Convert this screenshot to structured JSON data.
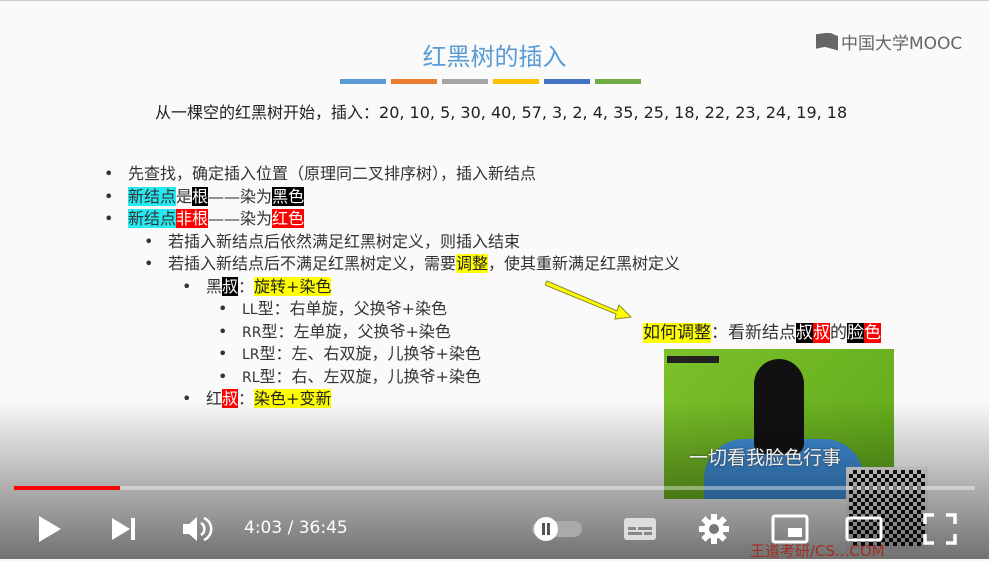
{
  "slide": {
    "title": "红黑树的插入",
    "logo": "中国大学MOOC",
    "title_bar_colors": [
      "#5b9bd5",
      "#ed7d31",
      "#a5a5a5",
      "#ffc000",
      "#4472c4",
      "#70ad47"
    ],
    "sequence_label": "从一棵空的红黑树开始，插入：",
    "sequence": "20, 10, 5, 30, 40, 57, 3, 2, 4, 35, 25, 18, 22, 23, 24, 19, 18",
    "lines": [
      [
        {
          "t": "先查找，确定插入位置（原理同二叉排序树），插入新结点",
          "s": ""
        }
      ],
      [
        {
          "t": "新结点",
          "s": "cyan"
        },
        {
          "t": "是",
          "s": ""
        },
        {
          "t": "根",
          "s": "black"
        },
        {
          "t": "——染为",
          "s": ""
        },
        {
          "t": "黑色",
          "s": "black"
        }
      ],
      [
        {
          "t": "新结点",
          "s": "cyan"
        },
        {
          "t": "非根",
          "s": "red"
        },
        {
          "t": "——染为",
          "s": ""
        },
        {
          "t": "红色",
          "s": "red"
        }
      ],
      [
        {
          "t": "若插入新结点后依然满足红黑树定义，则插入结束",
          "s": ""
        }
      ],
      [
        {
          "t": "若插入新结点后不满足红黑树定义，需要",
          "s": ""
        },
        {
          "t": "调整",
          "s": "yellow"
        },
        {
          "t": "，使其重新满足红黑树定义",
          "s": ""
        }
      ],
      [
        {
          "t": "黑",
          "s": ""
        },
        {
          "t": "叔",
          "s": "black"
        },
        {
          "t": "：",
          "s": ""
        },
        {
          "t": "旋转+染色",
          "s": "yellow"
        }
      ],
      [
        {
          "t": "LL",
          "s": "latin"
        },
        {
          "t": "型：右单旋，父换爷+染色",
          "s": ""
        }
      ],
      [
        {
          "t": "RR",
          "s": "latin"
        },
        {
          "t": "型：左单旋，父换爷+染色",
          "s": ""
        }
      ],
      [
        {
          "t": "LR",
          "s": "latin"
        },
        {
          "t": "型：左、右双旋，儿换爷+染色",
          "s": ""
        }
      ],
      [
        {
          "t": "RL",
          "s": "latin"
        },
        {
          "t": "型：右、左双旋，儿换爷+染色",
          "s": ""
        }
      ],
      [
        {
          "t": "红",
          "s": ""
        },
        {
          "t": "叔",
          "s": "red"
        },
        {
          "t": "：",
          "s": ""
        },
        {
          "t": "染色+变新",
          "s": "yellow"
        }
      ]
    ],
    "note": [
      {
        "t": "如何调整",
        "s": "yellow"
      },
      {
        "t": "：看新结点",
        "s": ""
      },
      {
        "t": "叔",
        "s": "black"
      },
      {
        "t": "叔",
        "s": "red"
      },
      {
        "t": "的",
        "s": ""
      },
      {
        "t": "脸",
        "s": "black"
      },
      {
        "t": "色",
        "s": "red"
      }
    ],
    "video_subtitle": "一切看我脸色行事",
    "footer": "王道考研/CS...COM"
  },
  "player": {
    "current_time": "4:03",
    "separator": " / ",
    "duration": "36:45",
    "progress_percent": 11,
    "accent": "#ff0000",
    "icons": [
      "play-icon",
      "next-icon",
      "volume-icon",
      "autoplay-toggle",
      "subtitles-icon",
      "settings-icon",
      "miniplayer-icon",
      "theater-icon",
      "fullscreen-icon"
    ]
  }
}
